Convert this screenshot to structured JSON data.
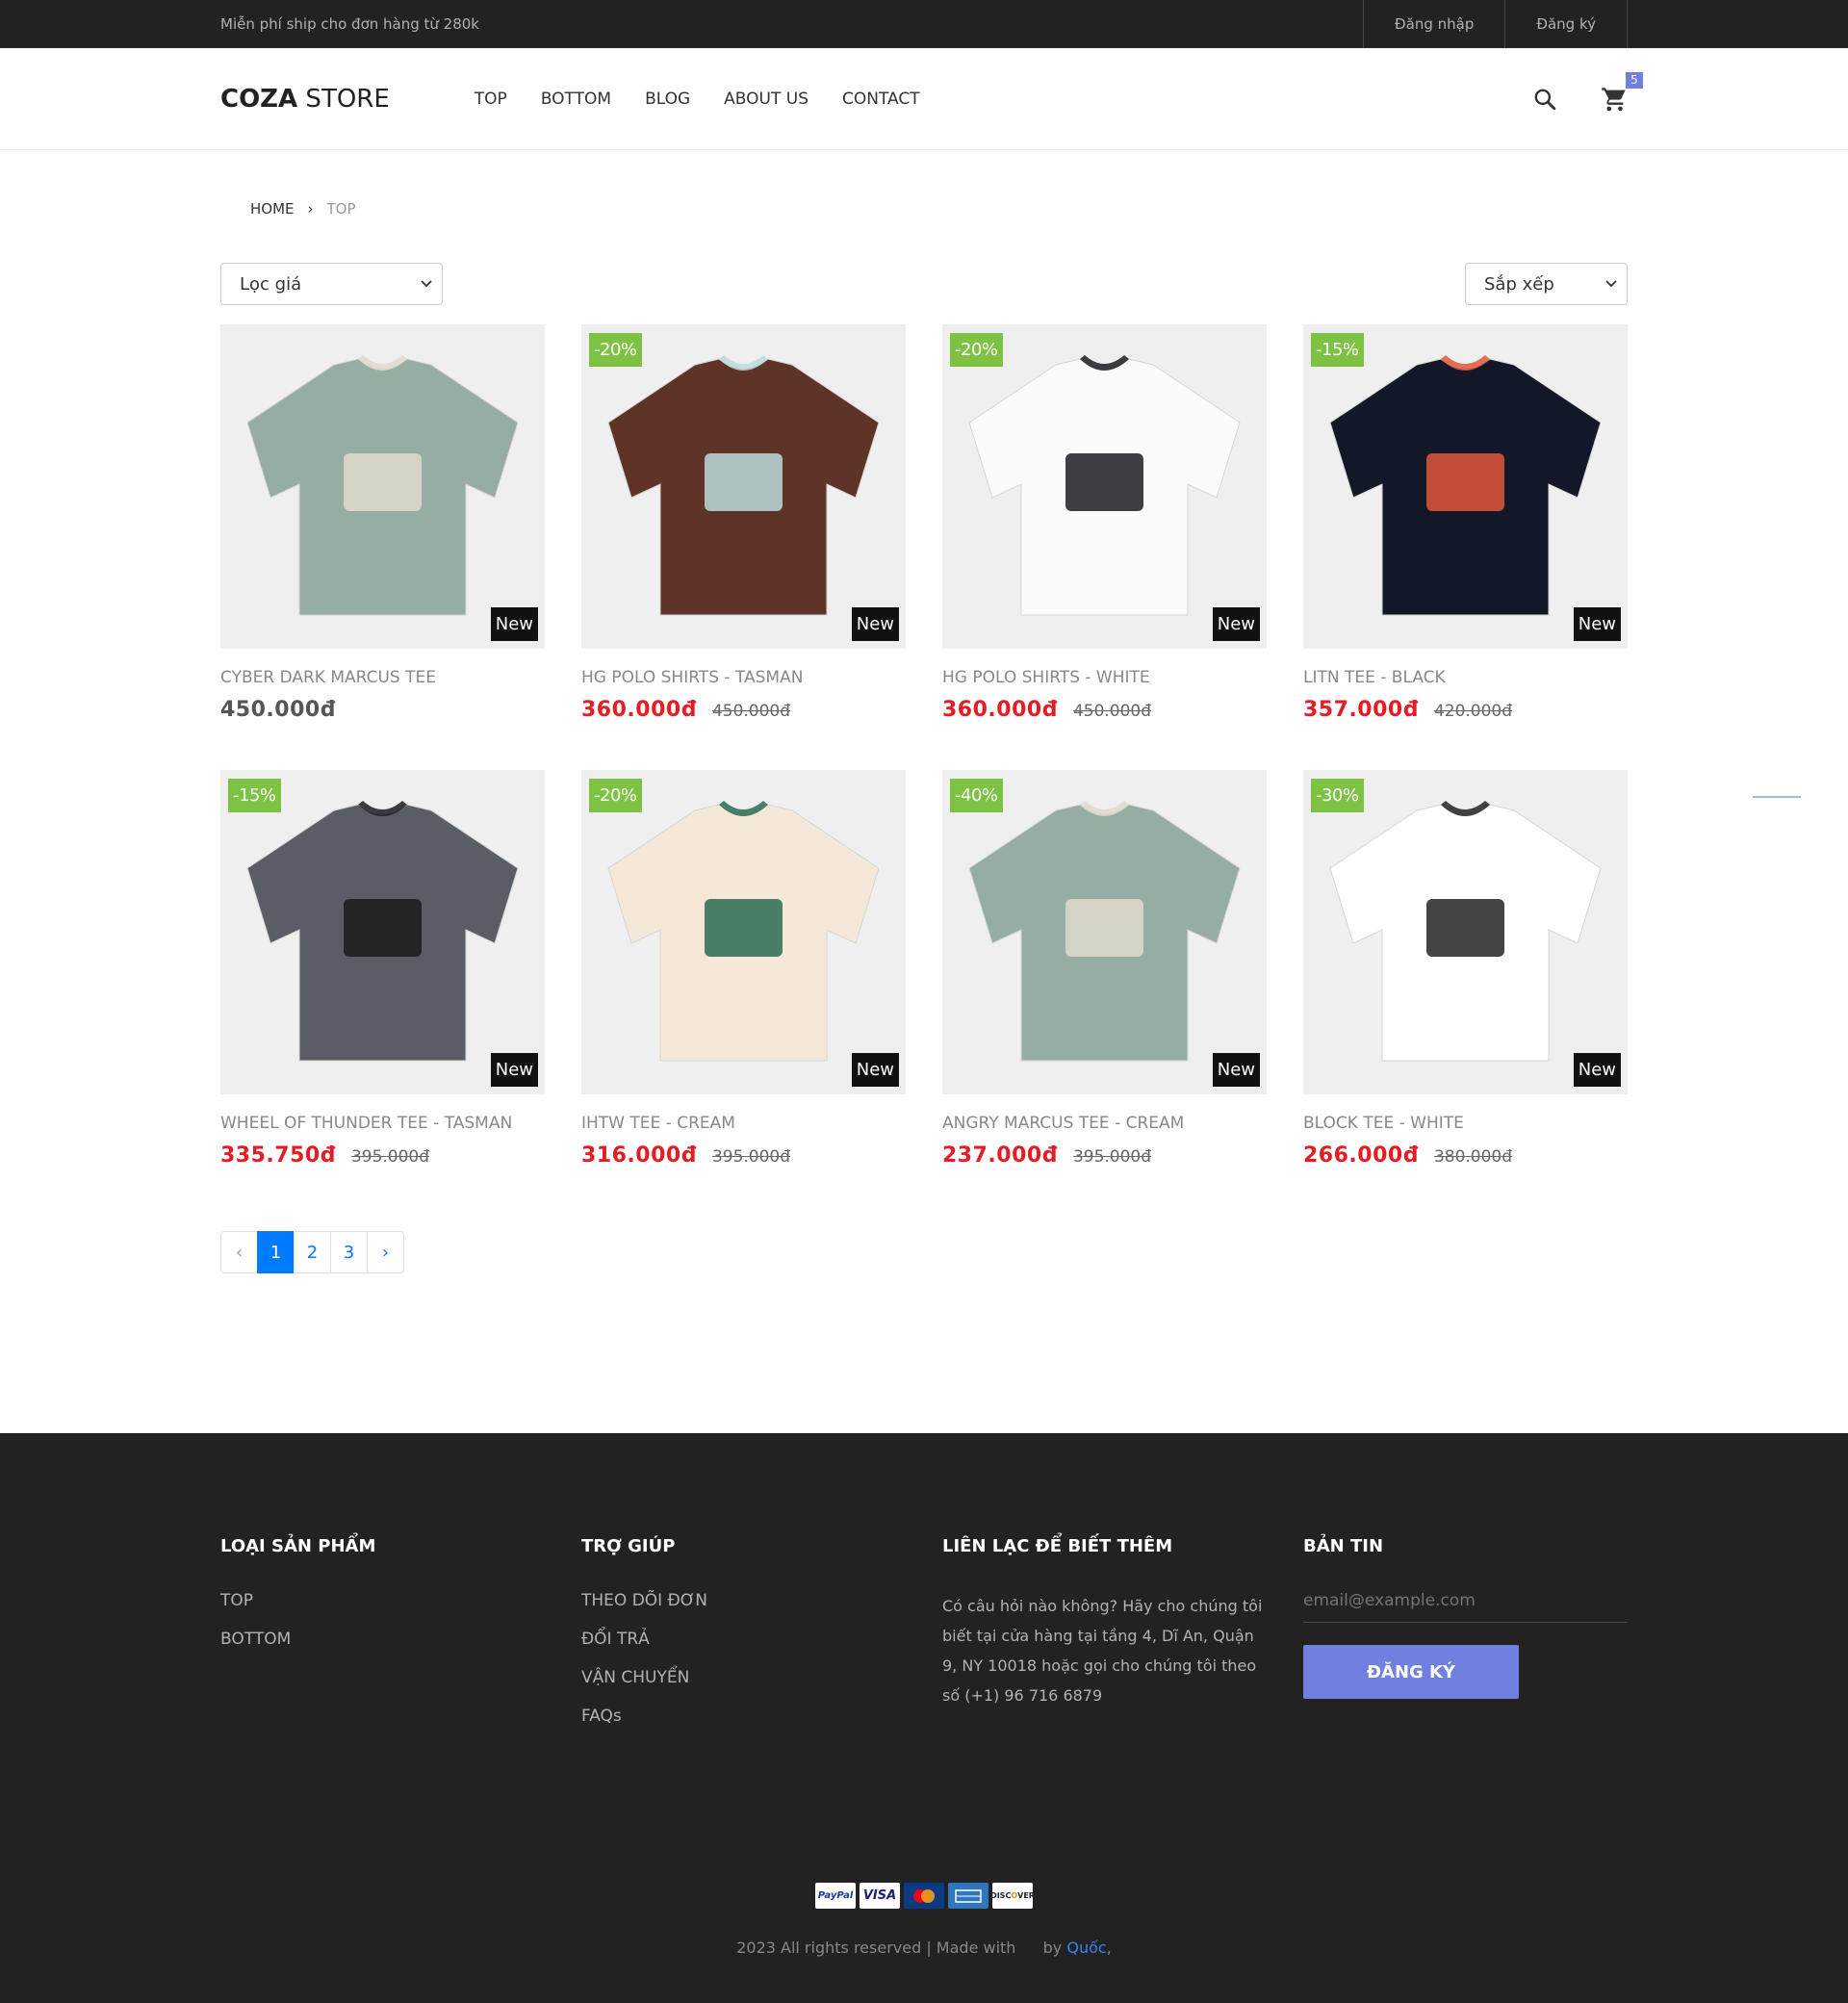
{
  "topbar": {
    "shipping": "Miễn phí ship cho đơn hàng từ 280k",
    "login": "Đăng nhập",
    "register": "Đăng ký"
  },
  "header": {
    "logo_bold": "COZA",
    "logo_light": " STORE",
    "nav": [
      "TOP",
      "BOTTOM",
      "BLOG",
      "ABOUT US",
      "CONTACT"
    ],
    "cart_count": "5",
    "icons": [
      "search-icon",
      "cart-icon"
    ]
  },
  "breadcrumb": {
    "home": "HOME",
    "current": "TOP"
  },
  "filters": {
    "price": "Lọc giá",
    "sort": "Sắp xếp"
  },
  "products": [
    {
      "name": "CYBER DARK MARCUS TEE",
      "price": "450.000đ",
      "old_price": "",
      "sale": "",
      "badge": "New",
      "color": "#95ada2",
      "accent": "#e1d8cc"
    },
    {
      "name": "HG POLO SHIRTS - TASMAN",
      "price": "360.000đ",
      "old_price": "450.000đ",
      "sale": "-20%",
      "badge": "New",
      "color": "#5e3428",
      "accent": "#bcd9da"
    },
    {
      "name": "HG POLO SHIRTS - WHITE",
      "price": "360.000đ",
      "old_price": "450.000đ",
      "sale": "-20%",
      "badge": "New",
      "color": "#fbfbfb",
      "accent": "#1b1b22"
    },
    {
      "name": "LITN TEE - BLACK",
      "price": "357.000đ",
      "old_price": "420.000đ",
      "sale": "-15%",
      "badge": "New",
      "color": "#131828",
      "accent": "#e2583c"
    },
    {
      "name": "WHEEL OF THUNDER TEE - TASMAN",
      "price": "335.750đ",
      "old_price": "395.000đ",
      "sale": "-15%",
      "badge": "New",
      "color": "#5a5c66",
      "accent": "#1b1b1e"
    },
    {
      "name": "IHTW TEE - CREAM",
      "price": "316.000đ",
      "old_price": "395.000đ",
      "sale": "-20%",
      "badge": "New",
      "color": "#f5e8d8",
      "accent": "#2a6b53"
    },
    {
      "name": "ANGRY MARCUS TEE - CREAM",
      "price": "237.000đ",
      "old_price": "395.000đ",
      "sale": "-40%",
      "badge": "New",
      "color": "#95ada2",
      "accent": "#e1d8cc"
    },
    {
      "name": "BLOCK TEE - WHITE",
      "price": "266.000đ",
      "old_price": "380.000đ",
      "sale": "-30%",
      "badge": "New",
      "color": "#ffffff",
      "accent": "#222222"
    }
  ],
  "pagination": {
    "prev": "‹",
    "pages": [
      "1",
      "2",
      "3"
    ],
    "next": "›",
    "active": "1"
  },
  "footer": {
    "categories_title": "LOẠI SẢN PHẨM",
    "categories": [
      "TOP",
      "BOTTOM"
    ],
    "help_title": "TRỢ GIÚP",
    "help": [
      "THEO DÕI ĐƠN",
      "ĐỔI TRẢ",
      "VẬN CHUYỂN",
      "FAQs"
    ],
    "contact_title": "LIÊN LẠC ĐỂ BIẾT THÊM",
    "contact_text": "Có câu hỏi nào không? Hãy cho chúng tôi biết tại cửa hàng tại tầng 4, Dĩ An, Quận 9, NY 10018 hoặc gọi cho chúng tôi theo số (+1) 96 716 6879",
    "newsletter_title": "BẢN TIN",
    "newsletter_placeholder": "email@example.com",
    "subscribe": "ĐĂNG KÝ",
    "payments": [
      "PayPal",
      "VISA",
      "MasterCard",
      "Amex",
      "Discover"
    ],
    "copyright": "2023 All rights reserved | Made with",
    "by": "by",
    "author": "Quốc",
    "author_suffix": ","
  }
}
